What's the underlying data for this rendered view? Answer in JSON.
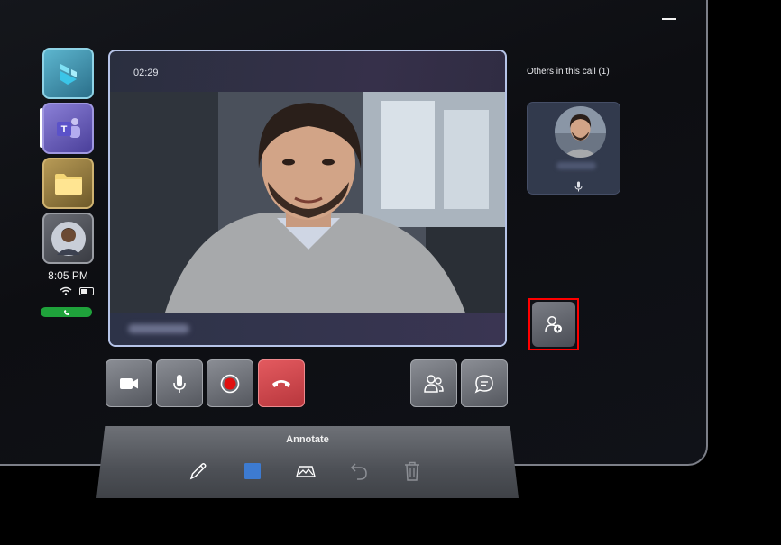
{
  "call": {
    "timer": "02:29",
    "others_label": "Others in this call (1)"
  },
  "status": {
    "time": "8:05 PM"
  },
  "rail": {
    "items": [
      "Dynamics 365 Guides",
      "Microsoft Teams",
      "Files",
      "Profile"
    ]
  },
  "annotate": {
    "title": "Annotate"
  },
  "colors": {
    "hangup": "#d9474d",
    "record": "#e01010",
    "call_pill": "#1fa23b",
    "highlight": "#ff0000",
    "shape_color": "#3d7bd1"
  },
  "icons": [
    "video-camera-icon",
    "microphone-icon",
    "record-icon",
    "hang-up-icon",
    "participants-icon",
    "chat-icon",
    "add-person-icon",
    "pen-icon",
    "color-swatch-icon",
    "mixed-reality-icon",
    "undo-icon",
    "trash-icon"
  ]
}
